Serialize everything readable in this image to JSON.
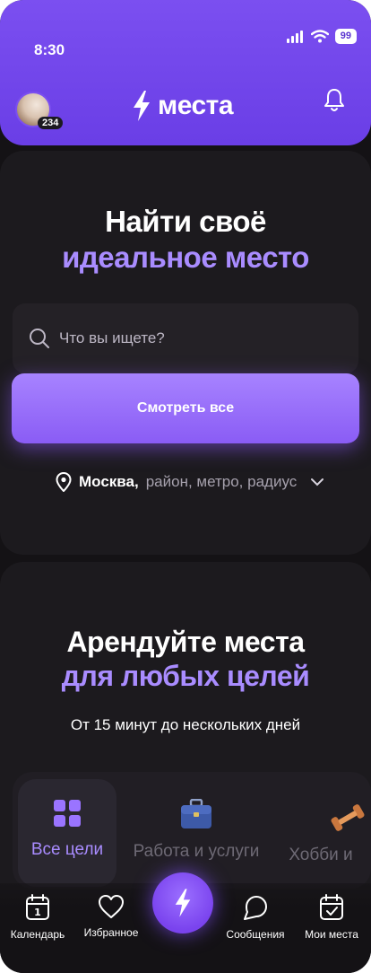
{
  "status_bar": {
    "time": "8:30",
    "battery": "99"
  },
  "header": {
    "brand_name": "места",
    "avatar_badge": "234"
  },
  "hero": {
    "title_line1": "Найти своё",
    "title_line2": "идеальное место",
    "search_placeholder": "Что вы ищете?",
    "cta_label": "Смотреть все",
    "location_city": "Москва,",
    "location_rest": "район, метро, радиус"
  },
  "rent": {
    "title_line1": "Арендуйте места",
    "title_line2": "для любых целей",
    "subtitle": "От 15 минут до нескольких дней"
  },
  "goals": [
    {
      "label": "Все цели",
      "icon": "grid-icon",
      "active": true
    },
    {
      "label": "Работа и услуги",
      "icon": "briefcase-icon",
      "active": false
    },
    {
      "label": "Хобби и",
      "icon": "dumbbell-icon",
      "active": false
    }
  ],
  "nav": {
    "calendar": "Календарь",
    "favorites": "Избранное",
    "messages": "Сообщения",
    "my_places": "Мои места",
    "calendar_day": "1"
  },
  "colors": {
    "accent": "#7b4ff0",
    "accent_light": "#a98cff",
    "background": "#141215",
    "card": "#1c1a1e"
  }
}
